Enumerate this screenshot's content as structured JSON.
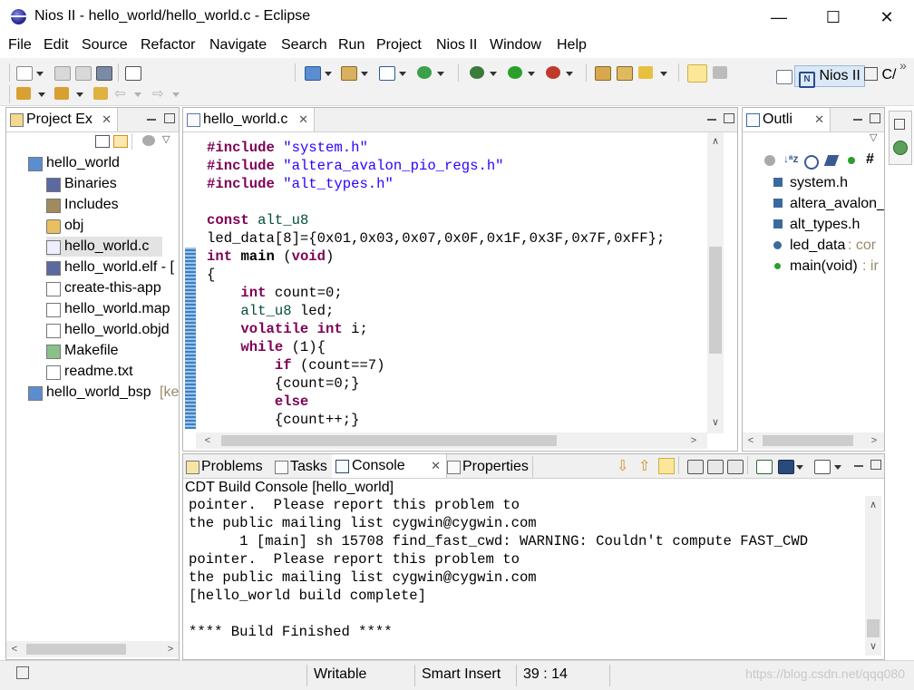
{
  "window": {
    "title": "Nios II - hello_world/hello_world.c - Eclipse",
    "minimize": "—",
    "maximize": "☐",
    "close": "✕"
  },
  "menu": [
    "File",
    "Edit",
    "Source",
    "Refactor",
    "Navigate",
    "Search",
    "Run",
    "Project",
    "Nios II",
    "Window",
    "Help"
  ],
  "perspective": {
    "active": "Nios II",
    "other": "C/",
    "more": "»"
  },
  "project_explorer": {
    "title": "Project Ex",
    "items": [
      {
        "label": "hello_world",
        "icon": "project-icon",
        "level": 0
      },
      {
        "label": "Binaries",
        "icon": "binaries-icon",
        "level": 1
      },
      {
        "label": "Includes",
        "icon": "includes-icon",
        "level": 1
      },
      {
        "label": "obj",
        "icon": "folder-icon",
        "level": 1
      },
      {
        "label": "hello_world.c",
        "icon": "c-file-icon",
        "level": 1,
        "selected": true
      },
      {
        "label": "hello_world.elf - [",
        "icon": "elf-icon",
        "level": 1
      },
      {
        "label": "create-this-app",
        "icon": "file-icon",
        "level": 1
      },
      {
        "label": "hello_world.map",
        "icon": "file-icon",
        "level": 1
      },
      {
        "label": "hello_world.objd",
        "icon": "file-icon",
        "level": 1
      },
      {
        "label": "Makefile",
        "icon": "makefile-icon",
        "level": 1
      },
      {
        "label": "readme.txt",
        "icon": "file-icon",
        "level": 1
      },
      {
        "label": "hello_world_bsp",
        "icon": "project-icon",
        "level": 0,
        "suffix": " [ke"
      }
    ]
  },
  "editor": {
    "tab": "hello_world.c",
    "lines": [
      [
        {
          "t": "#include ",
          "c": "pp"
        },
        {
          "t": "\"system.h\"",
          "c": "str"
        }
      ],
      [
        {
          "t": "#include ",
          "c": "pp"
        },
        {
          "t": "\"altera_avalon_pio_regs.h\"",
          "c": "str"
        }
      ],
      [
        {
          "t": "#include ",
          "c": "pp"
        },
        {
          "t": "\"alt_types.h\"",
          "c": "str"
        }
      ],
      [],
      [
        {
          "t": "const ",
          "c": "kw"
        },
        {
          "t": "alt_u8",
          "c": "typ"
        }
      ],
      [
        {
          "t": "led_data[8]={0x01,0x03,0x07,0x0F,0x1F,0x3F,0x7F,0xFF};",
          "c": ""
        }
      ],
      [
        {
          "t": "int ",
          "c": "kw"
        },
        {
          "t": "main ",
          "c": "kwb"
        },
        {
          "t": "(",
          "c": ""
        },
        {
          "t": "void",
          "c": "kw"
        },
        {
          "t": ")",
          "c": ""
        }
      ],
      [
        {
          "t": "{",
          "c": ""
        }
      ],
      [
        {
          "t": "    int ",
          "c": "kw"
        },
        {
          "t": "count=0;",
          "c": ""
        }
      ],
      [
        {
          "t": "    alt_u8",
          "c": "typ"
        },
        {
          "t": " led;",
          "c": ""
        }
      ],
      [
        {
          "t": "    volatile int ",
          "c": "kw"
        },
        {
          "t": "i;",
          "c": ""
        }
      ],
      [
        {
          "t": "    while ",
          "c": "kw"
        },
        {
          "t": "(1){",
          "c": ""
        }
      ],
      [
        {
          "t": "        if ",
          "c": "kw"
        },
        {
          "t": "(count==7)",
          "c": ""
        }
      ],
      [
        {
          "t": "        {count=0;}",
          "c": ""
        }
      ],
      [
        {
          "t": "        else",
          "c": "kw"
        }
      ],
      [
        {
          "t": "        {count++;}",
          "c": ""
        }
      ]
    ]
  },
  "outline": {
    "title": "Outli",
    "items": [
      {
        "label": "system.h",
        "extra": "",
        "icon": "include-icon"
      },
      {
        "label": "altera_avalon_",
        "extra": "",
        "icon": "include-icon"
      },
      {
        "label": "alt_types.h",
        "extra": "",
        "icon": "include-icon"
      },
      {
        "label": "led_data",
        "extra": " : cor",
        "icon": "variable-icon"
      },
      {
        "label": "main(void)",
        "extra": " : ir",
        "icon": "function-icon"
      }
    ]
  },
  "bottom": {
    "tabs": [
      "Problems",
      "Tasks",
      "Console",
      "Properties"
    ],
    "active_tab": "Console",
    "console_title": "CDT Build Console [hello_world]",
    "console_lines": [
      "pointer.  Please report this problem to",
      "the public mailing list cygwin@cygwin.com",
      "      1 [main] sh 15708 find_fast_cwd: WARNING: Couldn't compute FAST_CWD",
      "pointer.  Please report this problem to",
      "the public mailing list cygwin@cygwin.com",
      "[hello_world build complete]",
      "",
      "**** Build Finished ****"
    ]
  },
  "status": {
    "writable": "Writable",
    "insert_mode": "Smart Insert",
    "position": "39 : 14",
    "watermark": "https://blog.csdn.net/qqq080"
  }
}
